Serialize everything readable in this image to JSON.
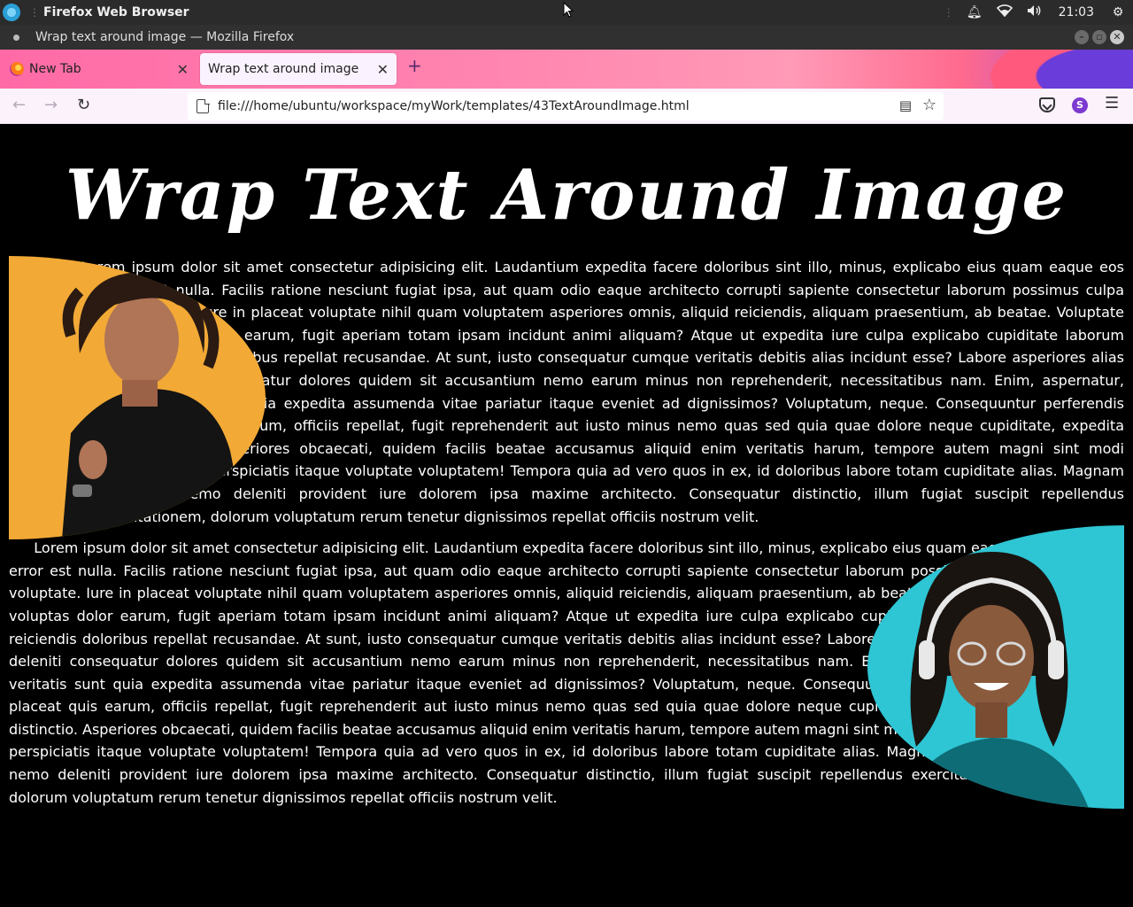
{
  "system": {
    "app_name": "Firefox Web Browser",
    "clock": "21:03"
  },
  "window": {
    "title": "Wrap text around image — Mozilla Firefox"
  },
  "tabs": [
    {
      "label": "New Tab",
      "active": false
    },
    {
      "label": "Wrap text around image",
      "active": true
    }
  ],
  "navbar": {
    "url": "file:///home/ubuntu/workspace/myWork/templates/43TextAroundImage.html",
    "account_initial": "S"
  },
  "page": {
    "title": "Wrap Text Around Image",
    "paragraph1": "Lorem ipsum dolor sit amet consectetur adipisicing elit. Laudantium expedita facere doloribus sint illo, minus, explicabo eius quam eaque eos error est nulla. Facilis ratione nesciunt fugiat ipsa, aut quam odio eaque architecto corrupti sapiente consectetur laborum possimus culpa voluptate. Iure in placeat voluptate nihil quam voluptatem asperiores omnis, aliquid reiciendis, aliquam praesentium, ab beatae. Voluptate voluptas dolor earum, fugit aperiam totam ipsam incidunt animi aliquam? Atque ut expedita iure culpa explicabo cupiditate laborum reiciendis doloribus repellat recusandae. At sunt, iusto consequatur cumque veritatis debitis alias incidunt esse? Labore asperiores alias deleniti consequatur dolores quidem sit accusantium nemo earum minus non reprehenderit, necessitatibus nam. Enim, aspernatur, veritatis sunt quia expedita assumenda vitae pariatur itaque eveniet ad dignissimos? Voluptatum, neque. Consequuntur perferendis placeat quis earum, officiis repellat, fugit reprehenderit aut iusto minus nemo quas sed quia quae dolore neque cupiditate, expedita distinctio. Asperiores obcaecati, quidem facilis beatae accusamus aliquid enim veritatis harum, tempore autem magni sint modi voluptates perspiciatis itaque voluptate voluptatem! Tempora quia ad vero quos in ex, id doloribus labore totam cupiditate alias. Magnam minima nemo deleniti provident iure dolorem ipsa maxime architecto. Consequatur distinctio, illum fugiat suscipit repellendus exercitationem, dolorum voluptatum rerum tenetur dignissimos repellat officiis nostrum velit.",
    "paragraph2": "Lorem ipsum dolor sit amet consectetur adipisicing elit. Laudantium expedita facere doloribus sint illo, minus, explicabo eius quam eaque eos error est nulla. Facilis ratione nesciunt fugiat ipsa, aut quam odio eaque architecto corrupti sapiente consectetur laborum possimus culpa voluptate. Iure in placeat voluptate nihil quam voluptatem asperiores omnis, aliquid reiciendis, aliquam praesentium, ab beatae. Voluptate voluptas dolor earum, fugit aperiam totam ipsam incidunt animi aliquam? Atque ut expedita iure culpa explicabo cupiditate laborum reiciendis doloribus repellat recusandae. At sunt, iusto consequatur cumque veritatis debitis alias incidunt esse? Labore asperiores alias deleniti consequatur dolores quidem sit accusantium nemo earum minus non reprehenderit, necessitatibus nam. Enim, aspernatur, veritatis sunt quia expedita assumenda vitae pariatur itaque eveniet ad dignissimos? Voluptatum, neque. Consequuntur perferendis placeat quis earum, officiis repellat, fugit reprehenderit aut iusto minus nemo quas sed quia quae dolore neque cupiditate, expedita distinctio. Asperiores obcaecati, quidem facilis beatae accusamus aliquid enim veritatis harum, tempore autem magni sint modi voluptates perspiciatis itaque voluptate voluptatem! Tempora quia ad vero quos in ex, id doloribus labore totam cupiditate alias. Magnam minima nemo deleniti provident iure dolorem ipsa maxime architecto. Consequatur distinctio, illum fugiat suscipit repellendus exercitationem, dolorum voluptatum rerum tenetur dignissimos repellat officiis nostrum velit."
  },
  "colors": {
    "page_background": "#000000",
    "photo1_background": "#f2a936",
    "photo2_background": "#2ec5d4"
  }
}
